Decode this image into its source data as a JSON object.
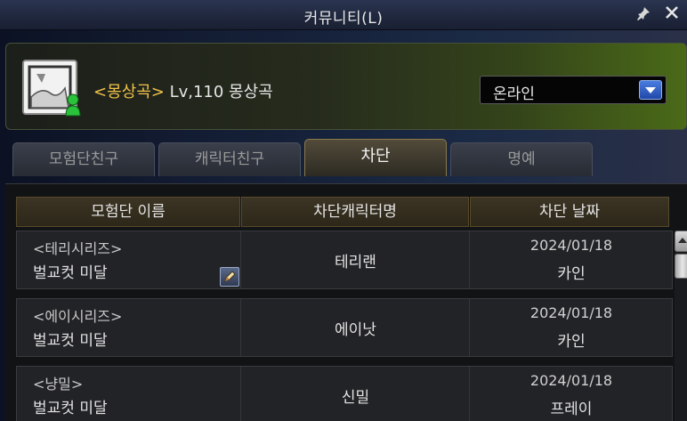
{
  "window": {
    "title": "커뮤니티(L)"
  },
  "profile": {
    "guild_tag": "<몽상곡>",
    "level_text": "Lv,110 몽상곡",
    "status_value": "온라인"
  },
  "tabs": [
    {
      "label": "모험단친구"
    },
    {
      "label": "캐릭터친구"
    },
    {
      "label": "차단"
    },
    {
      "label": "명예"
    }
  ],
  "active_tab": "차단",
  "table": {
    "headers": [
      "모험단 이름",
      "차단캐릭터명",
      "차단 날짜"
    ],
    "rows": [
      {
        "guild_tag": "<테리시리즈>",
        "guild_name": "벌교컷 미달",
        "char": "테리랜",
        "date": "2024/01/18",
        "server": "카인"
      },
      {
        "guild_tag": "<에이시리즈>",
        "guild_name": "벌교컷 미달",
        "char": "에이낫",
        "date": "2024/01/18",
        "server": "카인"
      },
      {
        "guild_tag": "<냥밀>",
        "guild_name": "벌교컷 미달",
        "char": "신밀",
        "date": "2024/01/18",
        "server": "프레이"
      }
    ]
  },
  "colors": {
    "guild_tag": "#f0c24a",
    "active_tab_border": "#8c7a4a",
    "select_arrow": "#2f5fcf"
  },
  "icons": [
    "pin-icon",
    "close-icon",
    "online-status-icon",
    "dropdown-arrow-icon",
    "memo-edit-icon",
    "scroll-up-icon"
  ]
}
